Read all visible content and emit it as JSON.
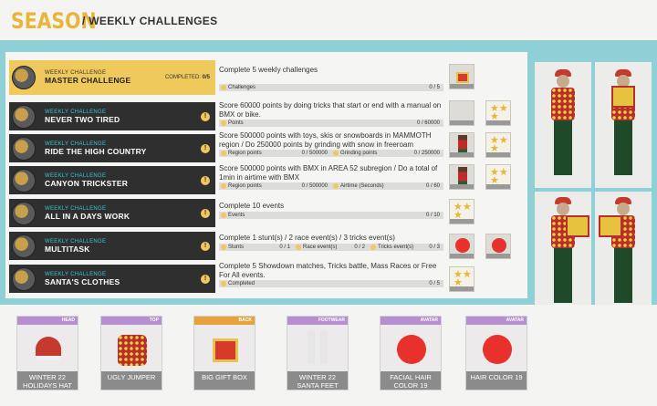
{
  "header": {
    "title": "SEASON",
    "crumb": "/ WEEKLY CHALLENGES"
  },
  "colors": {
    "gold": "#f0c95c",
    "teal": "#8fd0d7",
    "dark_row": "#2f2f2f",
    "accent_text": "#36c6d6"
  },
  "challenges": [
    {
      "sub": "WEEKLY CHALLENGE",
      "title": "MASTER CHALLENGE",
      "completed_label": "COMPLETED:",
      "completed_value": "0/5",
      "desc": "Complete 5 weekly challenges",
      "segments": [
        {
          "label": "Challenges",
          "value": "0 / 5"
        }
      ]
    },
    {
      "sub": "WEEKLY CHALLENGE",
      "title": "NEVER TWO TIRED",
      "desc": "Score 60000 points by doing tricks that start or end with a manual on BMX or bike.",
      "segments": [
        {
          "label": "Points",
          "value": "0 / 60000"
        }
      ]
    },
    {
      "sub": "WEEKLY CHALLENGE",
      "title": "RIDE THE HIGH COUNTRY",
      "desc": "Score 500000 points with toys, skis or snowboards  in MAMMOTH region / Do 250000 points by grinding with snow in freeroam",
      "segments": [
        {
          "label": "Region points",
          "value": "0 / 500000"
        },
        {
          "label": "Grinding points",
          "value": "0 / 250000"
        }
      ]
    },
    {
      "sub": "WEEKLY CHALLENGE",
      "title": "CANYON TRICKSTER",
      "desc": "Score 500000 points with BMX in AREA 52  subregion / Do a total of 1min in airtime with BMX",
      "segments": [
        {
          "label": "Region points",
          "value": "0 / 500000"
        },
        {
          "label": "Airtime (Seconds)",
          "value": "0 / 60"
        }
      ]
    },
    {
      "sub": "WEEKLY CHALLENGE",
      "title": "ALL IN A DAYS WORK",
      "desc": "Complete 10 events",
      "segments": [
        {
          "label": "Events",
          "value": "0 / 10"
        }
      ]
    },
    {
      "sub": "WEEKLY CHALLENGE",
      "title": "MULTITASK",
      "desc": "Complete 1 stunt(s) / 2 race event(s) / 3 tricks event(s)",
      "segments": [
        {
          "label": "Stunts",
          "value": "0 / 1"
        },
        {
          "label": "Race event(s)",
          "value": "0 / 2"
        },
        {
          "label": "Tricks event(s)",
          "value": "0 / 3"
        }
      ]
    },
    {
      "sub": "WEEKLY CHALLENGE",
      "title": "SANTA'S CLOTHES",
      "desc": "Complete 5 Showdown matches, Tricks battle, Mass Races or Free For All events.",
      "segments": [
        {
          "label": "Completed",
          "value": "0 / 5"
        }
      ]
    }
  ],
  "cards": [
    {
      "tag": "HEAD",
      "name": "WINTER 22 HOLIDAYS HAT",
      "art": "hat",
      "tag_color": "#b58fd0"
    },
    {
      "tag": "TOP",
      "name": "UGLY JUMPER",
      "art": "sweater",
      "tag_color": "#b58fd0"
    },
    {
      "tag": "BACK",
      "name": "BIG GIFT BOX",
      "art": "gift",
      "tag_color": "#e7a33b"
    },
    {
      "tag": "FOOTWEAR",
      "name": "WINTER 22 SANTA FEET",
      "art": "feet",
      "tag_color": "#b58fd0"
    },
    {
      "tag": "AVATAR",
      "name": "FACIAL HAIR COLOR 19",
      "art": "ball",
      "tag_color": "#b58fd0"
    },
    {
      "tag": "AVATAR",
      "name": "HAIR COLOR 19",
      "art": "ball",
      "tag_color": "#b58fd0"
    }
  ]
}
